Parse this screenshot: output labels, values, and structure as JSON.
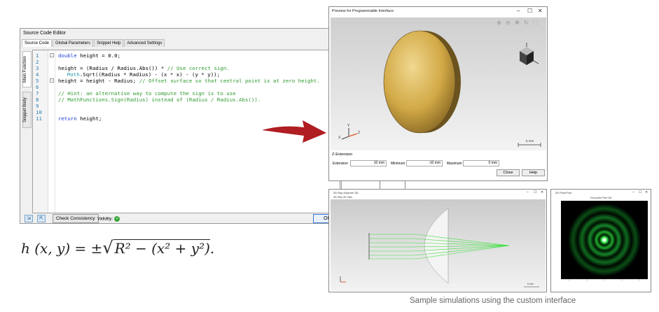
{
  "editor": {
    "title": "Source Code Editor",
    "tabs": [
      "Source Code",
      "Global Parameters",
      "Snippet Help",
      "Advanced Settings"
    ],
    "side_tabs": [
      "Main Function",
      "Snippet Body"
    ],
    "line_numbers": [
      "1",
      "2",
      "3",
      "4",
      "5",
      "6",
      "7",
      "8",
      "9",
      "10",
      "11"
    ],
    "code": {
      "l1_kw": "double",
      "l1_rest": " height = 0.0;",
      "l3_code": "height = (Radius / Radius.Abs()) * ",
      "l3_cm": "// Use correct sign.",
      "l4_tp": "Math",
      "l4_rest": ".Sqrt((Radius * Radius) - (x * x) - (y * y));",
      "l5_code": "height = height - Radius; ",
      "l5_cm": "// Offset surface so that central point is at zero height.",
      "l7_cm": "// Hint: an alternative way to compute the sign is to use",
      "l8_cm": "// MathFunctions.Sign(Radius) instead of (Radius / Radius.Abs()).",
      "l11_kw": "return",
      "l11_rest": " height;"
    },
    "check_consistency": "Check Consistency",
    "validity_label": "Validity:",
    "ok_label": "OK"
  },
  "formula": {
    "lhs": "h (x, y) = ±",
    "radicand": "R² − (x² + y²)",
    "end": "."
  },
  "preview": {
    "title": "Preview for Programmable Interface",
    "scale_label": "6 mm",
    "section_title": "Z-Extension",
    "extension_label": "Extension",
    "extension_value": "10 mm",
    "minimum_label": "Minimum",
    "minimum_value": "-10 mm",
    "maximum_label": "Maximum",
    "maximum_value": "0 mm",
    "close_label": "Close",
    "help_label": "Help",
    "icons": [
      "zoom-in-icon",
      "zoom-out-icon",
      "pan-icon",
      "rotate-icon",
      "fit-icon"
    ]
  },
  "raywin": {
    "title": "3D Ray Explorer 3D",
    "tabs": [
      "3D View",
      "2D View"
    ],
    "scale_label": "5 mm"
  },
  "fieldwin": {
    "title": "2D Field Plot",
    "header": "Chromatic Field Set"
  },
  "caption": "Sample simulations using the custom interface",
  "colors": {
    "arrow": "#b01d22",
    "lens": "#d8b450",
    "rays": "#3ce03c",
    "field_bg": "#000000",
    "field_ring": "#2fe04a"
  }
}
